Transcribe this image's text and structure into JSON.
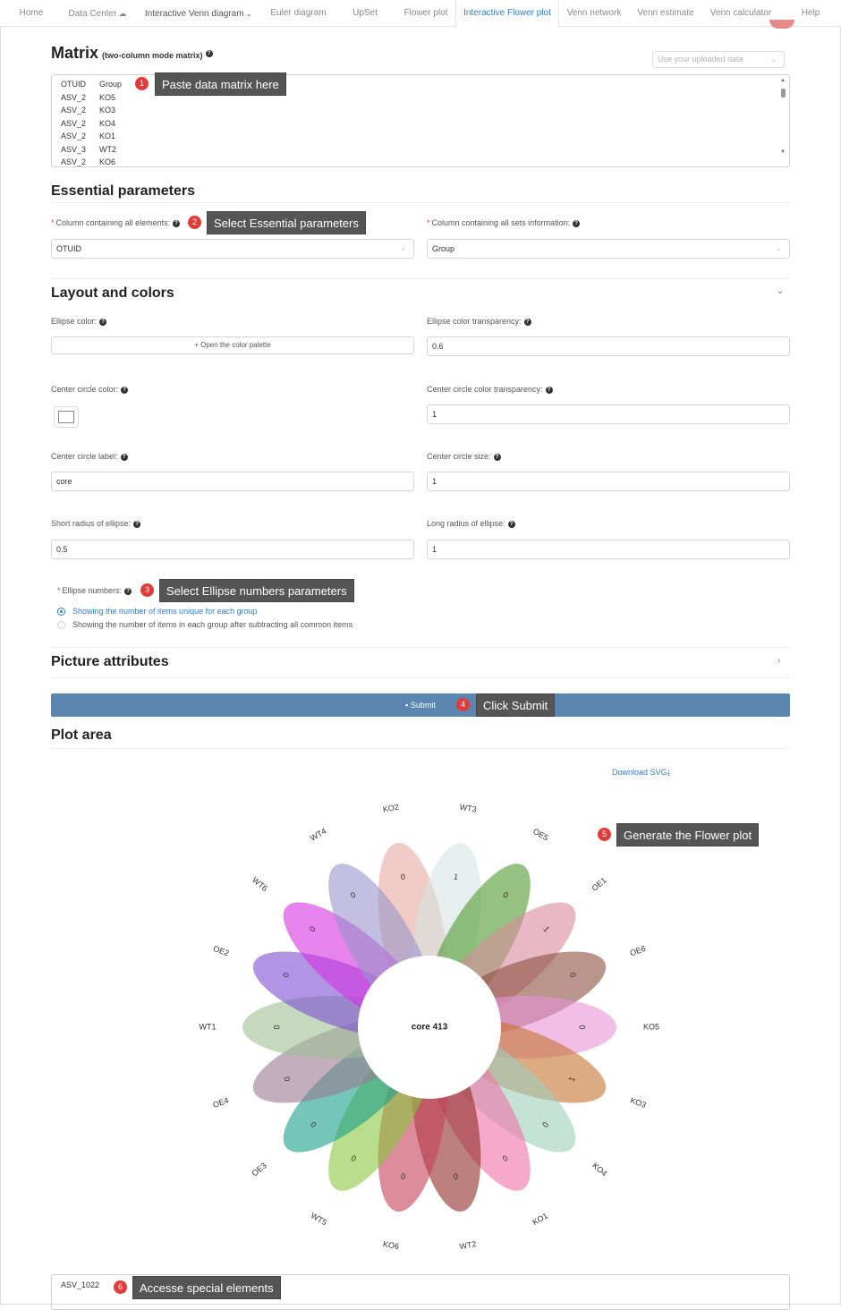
{
  "nav": {
    "items": [
      {
        "label": "Home"
      },
      {
        "label": "Data Center",
        "icon": "cloud-icon"
      },
      {
        "label": "Interactive Venn diagram",
        "icon": "chevron-down-icon"
      },
      {
        "label": "Euler diagram"
      },
      {
        "label": "UpSet"
      },
      {
        "label": "Flower plot"
      },
      {
        "label": "Interactive Flower plot"
      },
      {
        "label": "Venn network"
      },
      {
        "label": "Venn estimate"
      },
      {
        "label": "Venn calculator"
      },
      {
        "label": "Help"
      }
    ],
    "active": "Interactive Flower plot"
  },
  "matrix": {
    "title": "Matrix",
    "subtitle": "(two-column mode matrix)",
    "data_source_placeholder": "Use your uploaded data",
    "rows": [
      [
        "OTUID",
        "Group"
      ],
      [
        "ASV_2",
        "KO5"
      ],
      [
        "ASV_2",
        "KO3"
      ],
      [
        "ASV_2",
        "KO4"
      ],
      [
        "ASV_2",
        "KO1"
      ],
      [
        "ASV_3",
        "WT2"
      ],
      [
        "ASV_2",
        "KO6"
      ]
    ]
  },
  "essential": {
    "title": "Essential parameters",
    "elements_label": "Column containing all elements:",
    "elements_value": "OTUID",
    "sets_label": "Column containing all sets information:",
    "sets_value": "Group"
  },
  "layout": {
    "title": "Layout and colors",
    "ellipse_color_label": "Ellipse color:",
    "palette_button": "Open the color palette",
    "ellipse_transparency_label": "Ellipse color transparency:",
    "ellipse_transparency_value": "0.6",
    "center_color_label": "Center circle color:",
    "center_color_value": "#ffffff",
    "center_transparency_label": "Center circle color transparency:",
    "center_transparency_value": "1",
    "center_label_label": "Center circle label:",
    "center_label_value": "core",
    "center_size_label": "Center circle size:",
    "center_size_value": "1",
    "short_radius_label": "Short radius of ellipse:",
    "short_radius_value": "0.5",
    "long_radius_label": "Long radius of ellipse:",
    "long_radius_value": "1",
    "ellipse_numbers_label": "Ellipse numbers:",
    "option_unique": "Showing the number of items unique for each group",
    "option_subtract": "Showing the number of items in each group after subtracting all common items",
    "selected_option": "unique"
  },
  "picture": {
    "title": "Picture attributes"
  },
  "submit": {
    "label": "Submit"
  },
  "plot": {
    "title": "Plot area",
    "download_label": "Download SVG",
    "core_text": "core 413",
    "petals": [
      {
        "group": "KO2",
        "value": "0",
        "color": "#e8a9a0"
      },
      {
        "group": "WT3",
        "value": "1",
        "color": "#d5e4e1"
      },
      {
        "group": "OE5",
        "value": "0",
        "color": "#4f9a2c"
      },
      {
        "group": "OE1",
        "value": "1",
        "color": "#d98b9d"
      },
      {
        "group": "OE6",
        "value": "0",
        "color": "#8c4f3e"
      },
      {
        "group": "KO5",
        "value": "0",
        "color": "#e792d9"
      },
      {
        "group": "KO3",
        "value": "1",
        "color": "#c5732f"
      },
      {
        "group": "KO4",
        "value": "0",
        "color": "#9fcfbd"
      },
      {
        "group": "KO1",
        "value": "0",
        "color": "#f071a5"
      },
      {
        "group": "WT2",
        "value": "0",
        "color": "#8f2b25"
      },
      {
        "group": "KO6",
        "value": "0",
        "color": "#c7405a"
      },
      {
        "group": "WT5",
        "value": "0",
        "color": "#88c63f"
      },
      {
        "group": "OE3",
        "value": "0",
        "color": "#17a08a"
      },
      {
        "group": "OE4",
        "value": "0",
        "color": "#9a7a8e"
      },
      {
        "group": "WT1",
        "value": "0",
        "color": "#9fbf95"
      },
      {
        "group": "OE2",
        "value": "0",
        "color": "#7b4fd4"
      },
      {
        "group": "WT6",
        "value": "0",
        "color": "#d531e0"
      },
      {
        "group": "WT4",
        "value": "0",
        "color": "#9994cc"
      }
    ]
  },
  "special": {
    "value": "ASV_1022"
  },
  "callouts": [
    {
      "num": "1",
      "text": "Paste data matrix here"
    },
    {
      "num": "2",
      "text": "Select Essential parameters"
    },
    {
      "num": "3",
      "text": "Select Ellipse numbers parameters"
    },
    {
      "num": "4",
      "text": "Click Submit"
    },
    {
      "num": "5",
      "text": "Generate the Flower plot"
    },
    {
      "num": "6",
      "text": "Accesse special elements"
    }
  ]
}
